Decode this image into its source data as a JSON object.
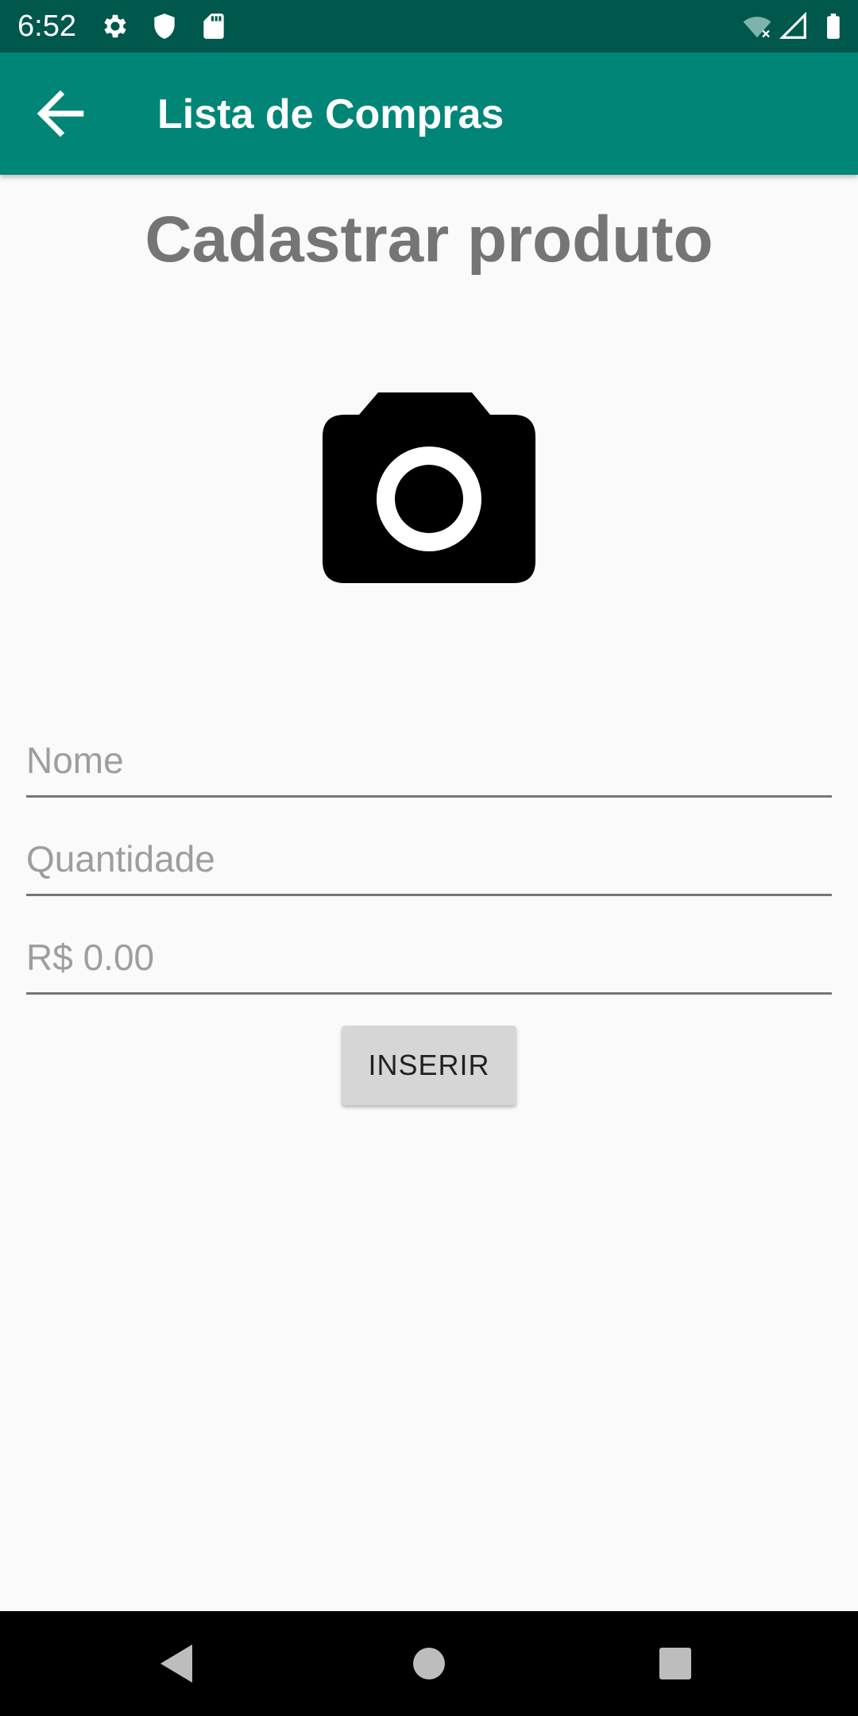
{
  "status_bar": {
    "time": "6:52",
    "icons": [
      "gear-icon",
      "shield-icon",
      "sd-card-icon",
      "wifi-off-icon",
      "signal-icon",
      "battery-icon"
    ]
  },
  "app_bar": {
    "title": "Lista de Compras",
    "back_icon": "arrow-back-icon"
  },
  "main": {
    "heading": "Cadastrar produto",
    "camera_icon": "camera-icon",
    "fields": {
      "nome_placeholder": "Nome",
      "quantidade_placeholder": "Quantidade",
      "preco_placeholder": "R$ 0.00"
    },
    "insert_label": "INSERIR"
  },
  "nav_bar": {
    "icons": [
      "back-triangle-icon",
      "home-circle-icon",
      "recents-square-icon"
    ]
  },
  "colors": {
    "status_bar": "#00574b",
    "app_bar": "#008577",
    "heading": "#757575",
    "button_bg": "#d6d6d6"
  }
}
